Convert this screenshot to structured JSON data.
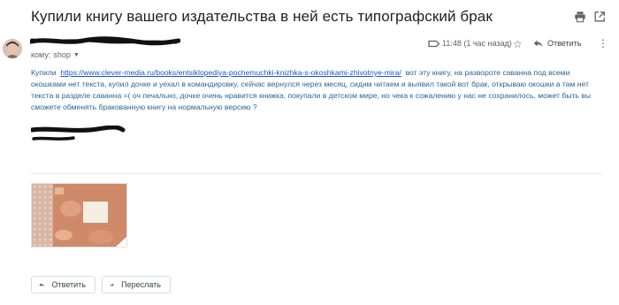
{
  "email": {
    "subject": "Купили книгу вашего издательства в ней есть типографский брак",
    "to_label": "кому:",
    "to_value": "shop",
    "time": "11:48 (1 час назад)",
    "reply_label": "Ответить",
    "body_prefix": "Купили",
    "link": "https://www.clever-media.ru/books/entsiklopediya-pochemuchki-knizhka-s-okoshkami-zhivotnye-mira/",
    "body_rest": "вот эту книгу, на развороте саванна под всеми окошками нет текста, купил дочке и уехал в командировку, сейчас вернулся через месяц, сидим читаем и выявил такой вот брак, открываю окошки а там нет текста в разделе саванна =( оч печально, дочке очень нравится книжка, покупали в детском мире, но чека к сожалению у нас не сохранилось, может быть вы сможете обменять бракованную книгу на нормальную версию ?"
  },
  "actions": {
    "reply": "Ответить",
    "forward": "Переслать"
  },
  "icons": {
    "print": "printer-icon",
    "open_new": "open-in-new-window-icon",
    "label": "label-icon",
    "star": "star-icon",
    "reply": "reply-icon",
    "more": "more-vertical-icon",
    "forward": "forward-icon"
  },
  "colors": {
    "link": "#1a56c9",
    "body_text": "#2a6496",
    "subject": "#202124"
  }
}
